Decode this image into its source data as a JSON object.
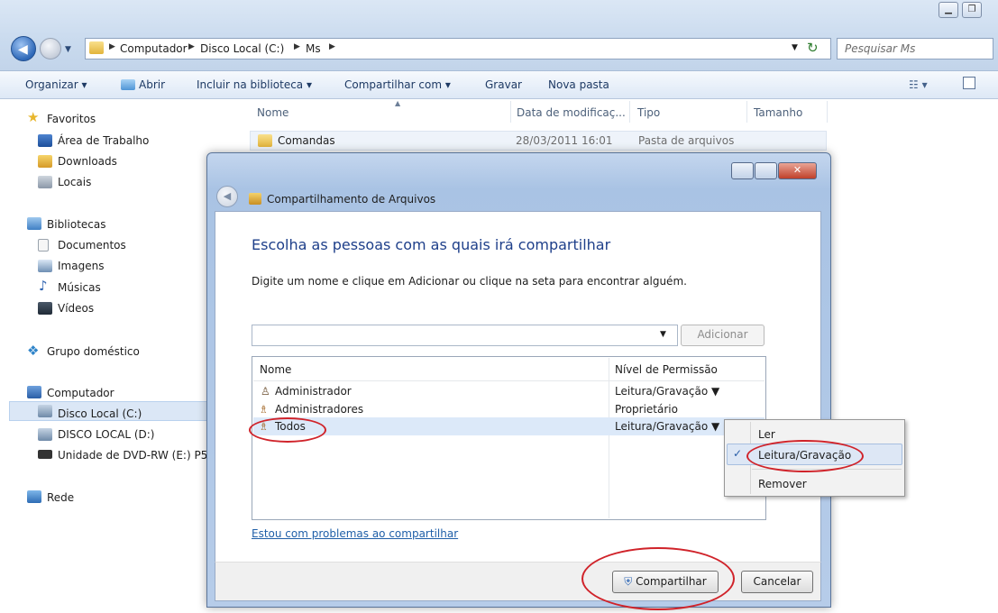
{
  "explorer": {
    "breadcrumb": [
      "Computador",
      "Disco Local (C:)",
      "Ms"
    ],
    "search_placeholder": "Pesquisar Ms",
    "toolbar": {
      "organize": "Organizar ▾",
      "open": "Abrir",
      "include_library": "Incluir na biblioteca ▾",
      "share_with": "Compartilhar com ▾",
      "burn": "Gravar",
      "new_folder": "Nova pasta"
    },
    "sidebar": {
      "favorites": "Favoritos",
      "desktop": "Área de Trabalho",
      "downloads": "Downloads",
      "places": "Locais",
      "libraries": "Bibliotecas",
      "documents": "Documentos",
      "images": "Imagens",
      "music": "Músicas",
      "videos": "Vídeos",
      "homegroup": "Grupo doméstico",
      "computer": "Computador",
      "local_disk_c": "Disco Local (C:)",
      "local_disk_d": "DISCO LOCAL (D:)",
      "dvd_drive": "Unidade de DVD-RW (E:) P5",
      "network": "Rede"
    },
    "columns": {
      "name": "Nome",
      "modified": "Data de modificaç...",
      "type": "Tipo",
      "size": "Tamanho"
    },
    "files": [
      {
        "name": "Comandas",
        "modified": "28/03/2011 16:01",
        "type": "Pasta de arquivos",
        "size": ""
      }
    ]
  },
  "dialog": {
    "title": "Compartilhamento de Arquivos",
    "heading": "Escolha as pessoas com as quais irá compartilhar",
    "instruction": "Digite um nome e clique em Adicionar ou clique na seta para encontrar alguém.",
    "input_value": "",
    "add_button": "Adicionar",
    "list_header": {
      "name": "Nome",
      "permission": "Nível de Permissão"
    },
    "rows": [
      {
        "name": "Administrador",
        "permission": "Leitura/Gravação ▼"
      },
      {
        "name": "Administradores",
        "permission": "Proprietário"
      },
      {
        "name": "Todos",
        "permission": "Leitura/Gravação ▼"
      }
    ],
    "help_link": "Estou com problemas ao compartilhar",
    "share_button": "Compartilhar",
    "cancel_button": "Cancelar"
  },
  "context_menu": {
    "items": [
      "Ler",
      "Leitura/Gravação",
      "Remover"
    ],
    "checked_index": 1,
    "check_mark": "✓"
  },
  "colors": {
    "dialog_heading": "#1e3f8a",
    "link": "#1f5fa8",
    "highlight_circle": "#d0232a",
    "selected_row": "#dce9f9"
  }
}
